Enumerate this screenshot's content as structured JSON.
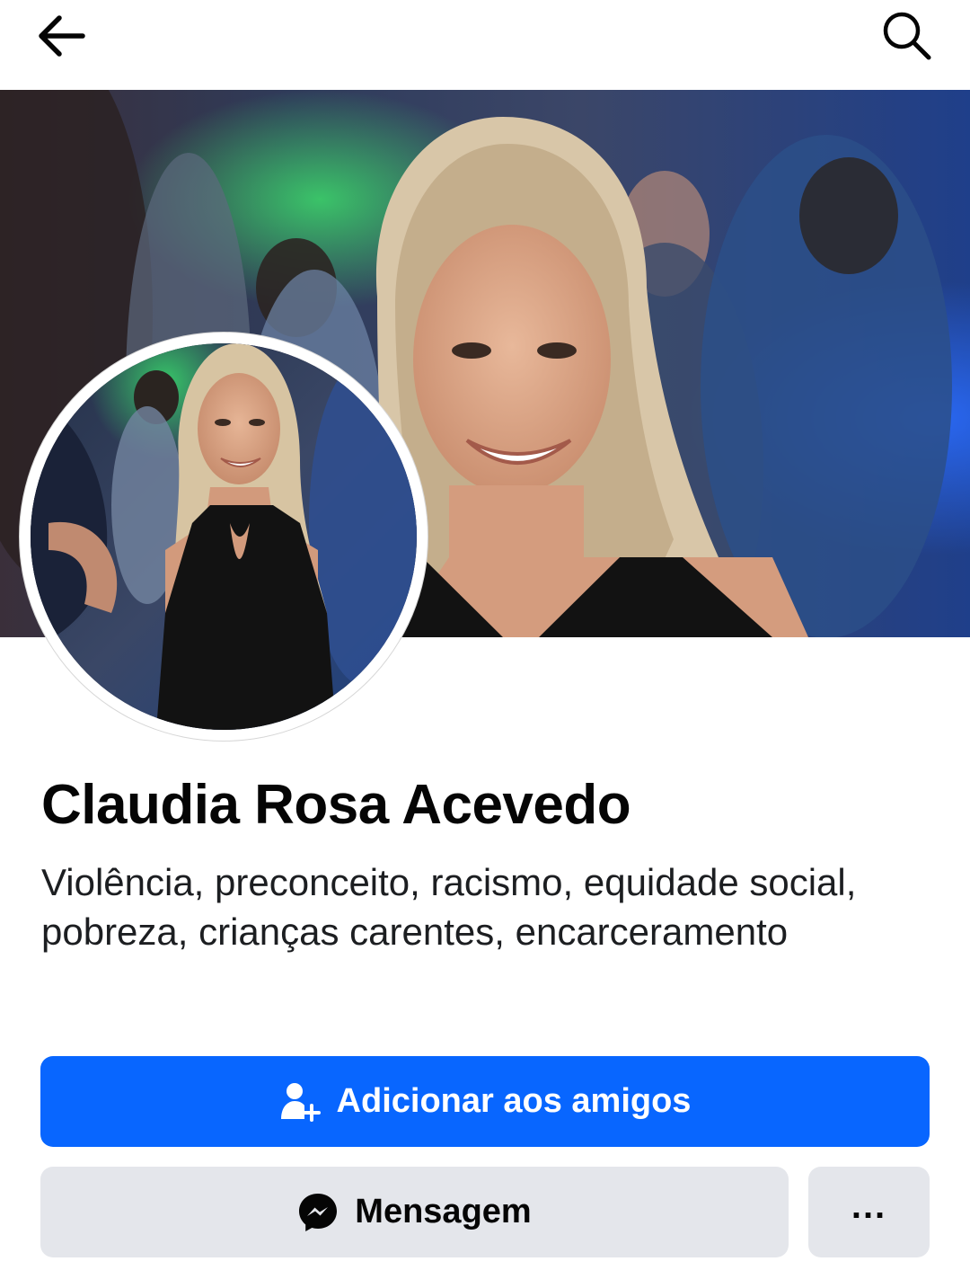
{
  "header": {
    "back_icon": "arrow-left-icon",
    "search_icon": "search-icon"
  },
  "profile": {
    "name": "Claudia Rosa Acevedo",
    "bio": "Violência, preconceito, racismo, equidade social, pobreza, crianças carentes, encarceramento"
  },
  "actions": {
    "add_friend_label": "Adicionar aos amigos",
    "add_friend_icon": "person-add-icon",
    "message_label": "Mensagem",
    "message_icon": "messenger-icon",
    "more_label": "...",
    "more_icon": "more-dots-icon"
  },
  "colors": {
    "primary": "#0866ff",
    "secondary_button": "#e4e6eb",
    "text": "#050505"
  }
}
